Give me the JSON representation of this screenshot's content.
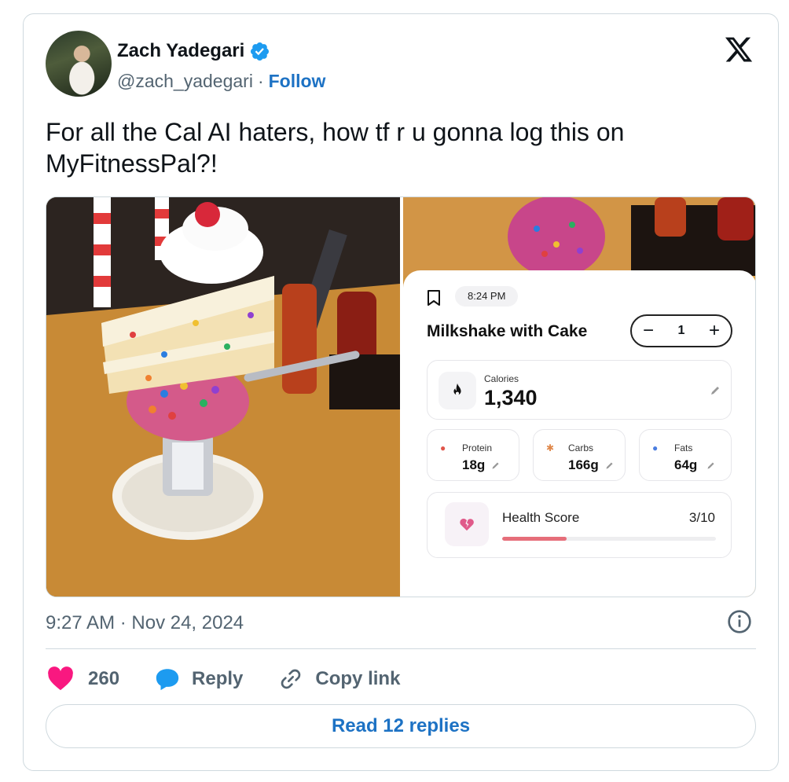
{
  "author": {
    "name": "Zach Yadegari",
    "handle": "@zach_yadegari",
    "separator": "·",
    "follow_label": "Follow",
    "verified": true
  },
  "tweet": {
    "text": "For all the Cal AI haters, how tf r u gonna log this on MyFitnessPal?!",
    "timestamp": "9:27 AM · Nov 24, 2024"
  },
  "media": {
    "left_photo": "milkshake-with-cake-photo",
    "right_screenshot": {
      "time": "8:24 PM",
      "food_name": "Milkshake with Cake",
      "quantity": "1",
      "calories": {
        "label": "Calories",
        "value": "1,340"
      },
      "macros": [
        {
          "label": "Protein",
          "value": "18g",
          "icon": "drumstick-icon",
          "color": "#e0554a"
        },
        {
          "label": "Carbs",
          "value": "166g",
          "icon": "wheat-icon",
          "color": "#e0884a"
        },
        {
          "label": "Fats",
          "value": "64g",
          "icon": "droplet-icon",
          "color": "#4a7de0"
        }
      ],
      "health_score": {
        "label": "Health Score",
        "value": "3/10",
        "fraction": 0.3
      }
    }
  },
  "actions": {
    "likes": "260",
    "reply_label": "Reply",
    "copy_link_label": "Copy link",
    "read_replies_label": "Read 12 replies"
  },
  "colors": {
    "link": "#1d72c4",
    "like": "#f91880",
    "reply": "#1d9bf0",
    "muted": "#536471",
    "health_bar": "#e66e7a"
  }
}
